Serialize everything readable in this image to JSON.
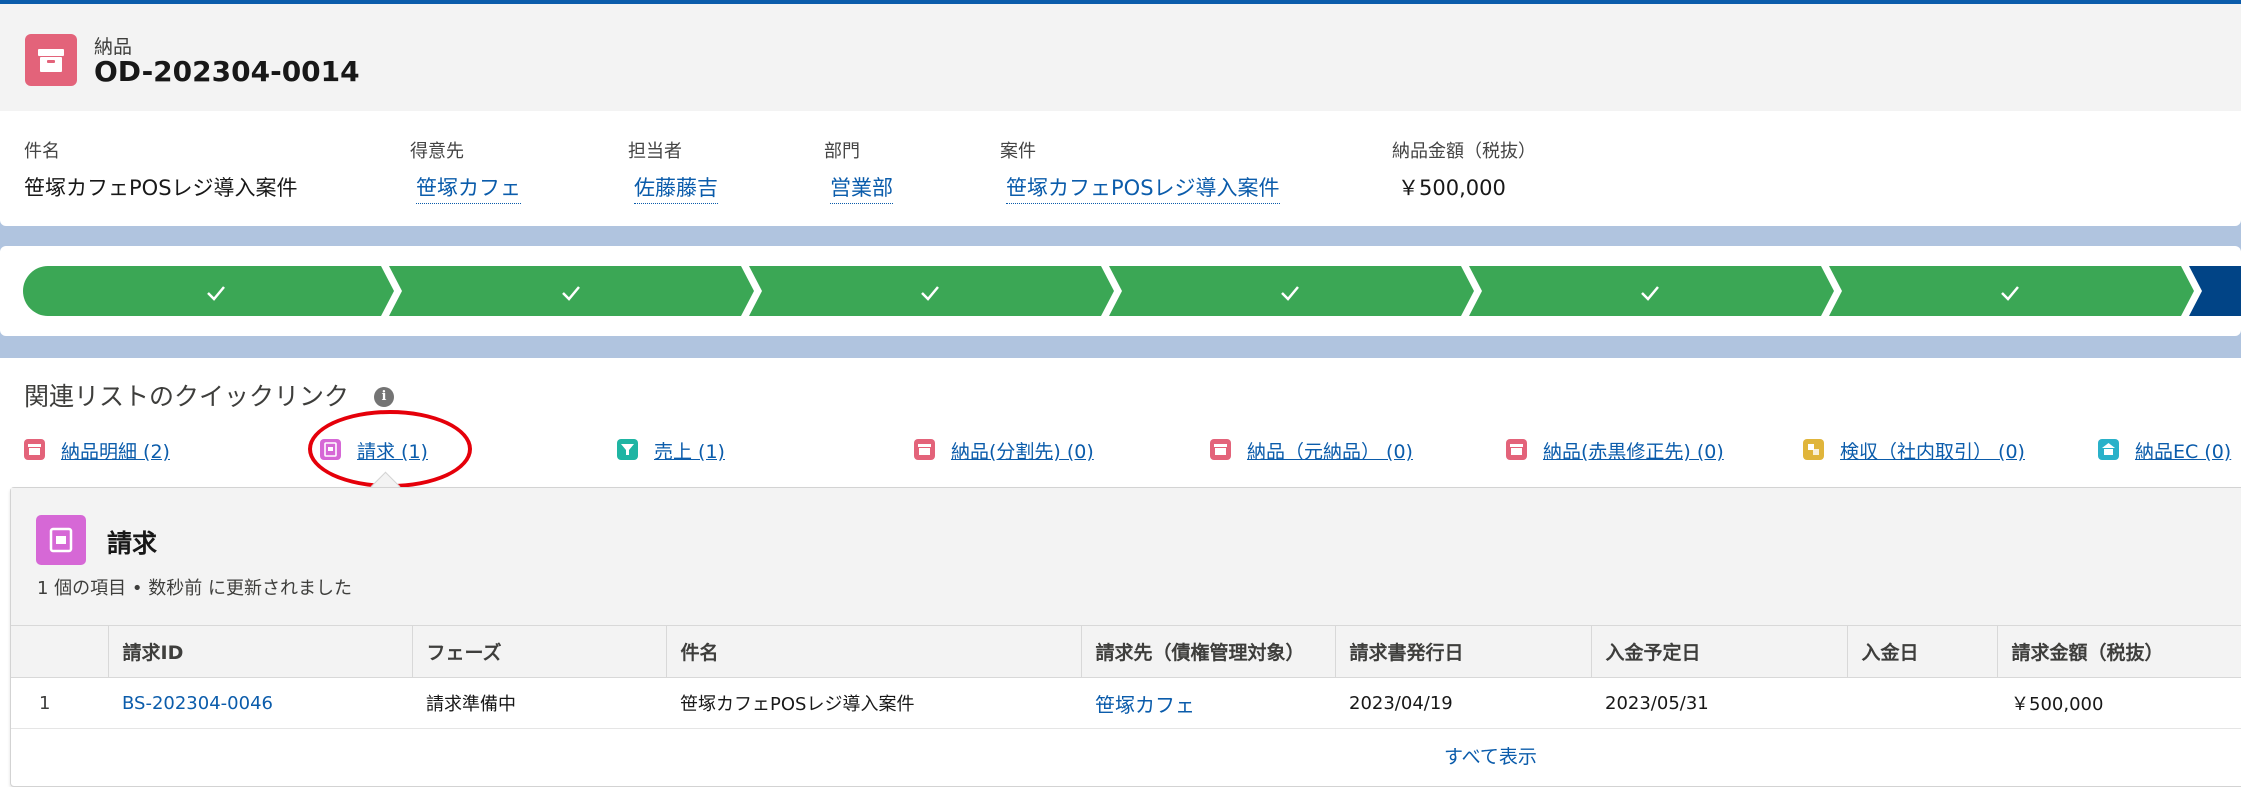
{
  "record": {
    "object_type": "納品",
    "name": "OD-202304-0014",
    "icon": "archive-box-icon",
    "icon_color": "#e3637a"
  },
  "fields": [
    {
      "label": "件名",
      "value": "笹塚カフェPOSレジ導入案件",
      "link": false
    },
    {
      "label": "得意先",
      "value": "笹塚カフェ",
      "link": true
    },
    {
      "label": "担当者",
      "value": "佐藤藤吉",
      "link": true
    },
    {
      "label": "部門",
      "value": "営業部",
      "link": true
    },
    {
      "label": "案件",
      "value": "笹塚カフェPOSレジ導入案件",
      "link": true
    },
    {
      "label": "納品金額（税抜）",
      "value": "￥500,000",
      "link": false
    }
  ],
  "path": {
    "completed_color": "#3ba755",
    "current_color": "#014486",
    "steps": [
      {
        "state": "complete",
        "mark": "✓"
      },
      {
        "state": "complete",
        "mark": "✓"
      },
      {
        "state": "complete",
        "mark": "✓"
      },
      {
        "state": "complete",
        "mark": "✓"
      },
      {
        "state": "complete",
        "mark": "✓"
      },
      {
        "state": "complete",
        "mark": "✓"
      },
      {
        "state": "current",
        "mark": ""
      }
    ]
  },
  "quick_links": {
    "title": "関連リストのクイックリンク",
    "info_icon": "info-icon",
    "items": [
      {
        "label": "納品明細 (2)",
        "icon": "archive-box-icon",
        "color": "#e3637a"
      },
      {
        "label": "請求 (1)",
        "icon": "invoice-icon",
        "color": "#d668d6"
      },
      {
        "label": "売上 (1)",
        "icon": "funnel-icon",
        "color": "#1fb5a3"
      },
      {
        "label": "納品(分割先) (0)",
        "icon": "archive-box-icon",
        "color": "#e3637a"
      },
      {
        "label": "納品（元納品） (0)",
        "icon": "archive-box-icon",
        "color": "#e3637a"
      },
      {
        "label": "納品(赤黒修正先) (0)",
        "icon": "archive-box-icon",
        "color": "#e3637a"
      },
      {
        "label": "検収（社内取引） (0)",
        "icon": "handshake-icon",
        "color": "#e0b53b"
      },
      {
        "label": "納品EC (0)",
        "icon": "store-icon",
        "color": "#2ab1c9"
      }
    ],
    "highlight_color": "#e5000a"
  },
  "related_list": {
    "title": "請求",
    "icon": "invoice-icon",
    "meta": "1 個の項目 • 数秒前 に更新されました",
    "columns": [
      "",
      "請求ID",
      "フェーズ",
      "件名",
      "請求先（債権管理対象）",
      "請求書発行日",
      "入金予定日",
      "入金日",
      "請求金額（税抜）"
    ],
    "rows": [
      [
        "1",
        "BS-202304-0046",
        "請求準備中",
        "笹塚カフェPOSレジ導入案件",
        "笹塚カフェ",
        "2023/04/19",
        "2023/05/31",
        "",
        "￥500,000"
      ]
    ],
    "view_all": "すべて表示"
  }
}
